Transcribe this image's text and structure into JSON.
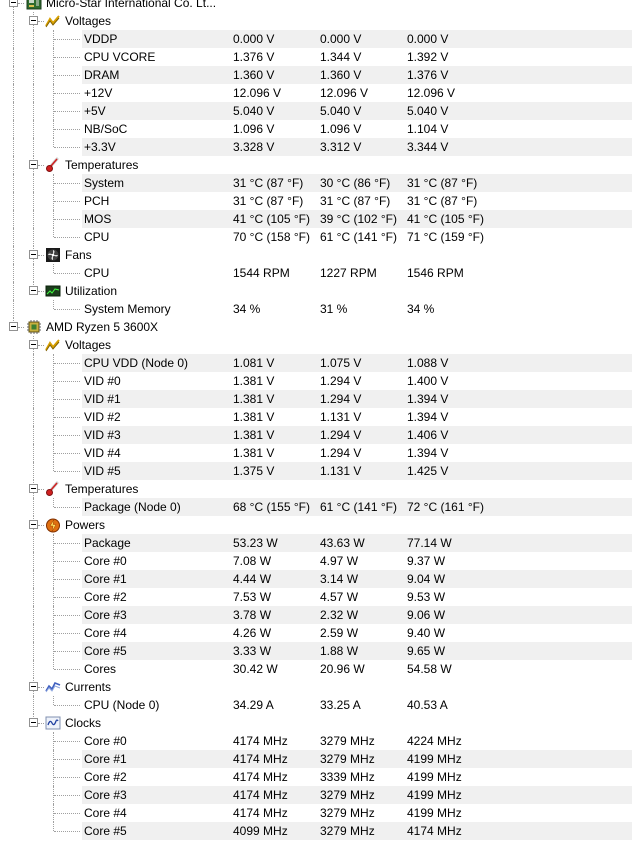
{
  "tree": [
    {
      "type": "device",
      "id": "msi",
      "name": "Micro-Star International Co. Lt...",
      "icon": "motherboard-icon",
      "groups": [
        {
          "id": "msi-voltages",
          "name": "Voltages",
          "icon": "voltage-icon",
          "rows": [
            {
              "label": "VDDP",
              "values": [
                "0.000 V",
                "0.000 V",
                "0.000 V"
              ]
            },
            {
              "label": "CPU VCORE",
              "values": [
                "1.376 V",
                "1.344 V",
                "1.392 V"
              ]
            },
            {
              "label": "DRAM",
              "values": [
                "1.360 V",
                "1.360 V",
                "1.376 V"
              ]
            },
            {
              "label": "+12V",
              "values": [
                "12.096 V",
                "12.096 V",
                "12.096 V"
              ]
            },
            {
              "label": "+5V",
              "values": [
                "5.040 V",
                "5.040 V",
                "5.040 V"
              ]
            },
            {
              "label": "NB/SoC",
              "values": [
                "1.096 V",
                "1.096 V",
                "1.104 V"
              ]
            },
            {
              "label": "+3.3V",
              "values": [
                "3.328 V",
                "3.312 V",
                "3.344 V"
              ]
            }
          ]
        },
        {
          "id": "msi-temperatures",
          "name": "Temperatures",
          "icon": "thermometer-icon",
          "rows": [
            {
              "label": "System",
              "values": [
                "31 °C  (87 °F)",
                "30 °C  (86 °F)",
                "31 °C  (87 °F)"
              ]
            },
            {
              "label": "PCH",
              "values": [
                "31 °C  (87 °F)",
                "31 °C  (87 °F)",
                "31 °C  (87 °F)"
              ]
            },
            {
              "label": "MOS",
              "values": [
                "41 °C  (105 °F)",
                "39 °C  (102 °F)",
                "41 °C  (105 °F)"
              ]
            },
            {
              "label": "CPU",
              "values": [
                "70 °C  (158 °F)",
                "61 °C  (141 °F)",
                "71 °C  (159 °F)"
              ]
            }
          ]
        },
        {
          "id": "msi-fans",
          "name": "Fans",
          "icon": "fan-icon",
          "rows": [
            {
              "label": "CPU",
              "values": [
                "1544 RPM",
                "1227 RPM",
                "1546 RPM"
              ]
            }
          ]
        },
        {
          "id": "msi-utilization",
          "name": "Utilization",
          "icon": "utilization-icon",
          "rows": [
            {
              "label": "System Memory",
              "values": [
                "34 %",
                "31 %",
                "34 %"
              ]
            }
          ]
        }
      ]
    },
    {
      "type": "device",
      "id": "cpu",
      "name": "AMD Ryzen 5 3600X",
      "icon": "cpu-chip-icon",
      "groups": [
        {
          "id": "cpu-voltages",
          "name": "Voltages",
          "icon": "voltage-icon",
          "rows": [
            {
              "label": "CPU VDD (Node 0)",
              "values": [
                "1.081 V",
                "1.075 V",
                "1.088 V"
              ]
            },
            {
              "label": "VID #0",
              "values": [
                "1.381 V",
                "1.294 V",
                "1.400 V"
              ]
            },
            {
              "label": "VID #1",
              "values": [
                "1.381 V",
                "1.294 V",
                "1.394 V"
              ]
            },
            {
              "label": "VID #2",
              "values": [
                "1.381 V",
                "1.131 V",
                "1.394 V"
              ]
            },
            {
              "label": "VID #3",
              "values": [
                "1.381 V",
                "1.294 V",
                "1.406 V"
              ]
            },
            {
              "label": "VID #4",
              "values": [
                "1.381 V",
                "1.294 V",
                "1.394 V"
              ]
            },
            {
              "label": "VID #5",
              "values": [
                "1.375 V",
                "1.131 V",
                "1.425 V"
              ]
            }
          ]
        },
        {
          "id": "cpu-temperatures",
          "name": "Temperatures",
          "icon": "thermometer-icon",
          "rows": [
            {
              "label": "Package (Node 0)",
              "values": [
                "68 °C  (155 °F)",
                "61 °C  (141 °F)",
                "72 °C  (161 °F)"
              ]
            }
          ]
        },
        {
          "id": "cpu-powers",
          "name": "Powers",
          "icon": "power-icon",
          "rows": [
            {
              "label": "Package",
              "values": [
                "53.23 W",
                "43.63 W",
                "77.14 W"
              ]
            },
            {
              "label": "Core #0",
              "values": [
                "7.08 W",
                "4.97 W",
                "9.37 W"
              ]
            },
            {
              "label": "Core #1",
              "values": [
                "4.44 W",
                "3.14 W",
                "9.04 W"
              ]
            },
            {
              "label": "Core #2",
              "values": [
                "7.53 W",
                "4.57 W",
                "9.53 W"
              ]
            },
            {
              "label": "Core #3",
              "values": [
                "3.78 W",
                "2.32 W",
                "9.06 W"
              ]
            },
            {
              "label": "Core #4",
              "values": [
                "4.26 W",
                "2.59 W",
                "9.40 W"
              ]
            },
            {
              "label": "Core #5",
              "values": [
                "3.33 W",
                "1.88 W",
                "9.65 W"
              ]
            },
            {
              "label": "Cores",
              "values": [
                "30.42 W",
                "20.96 W",
                "54.58 W"
              ]
            }
          ]
        },
        {
          "id": "cpu-currents",
          "name": "Currents",
          "icon": "current-icon",
          "rows": [
            {
              "label": "CPU (Node 0)",
              "values": [
                "34.29 A",
                "33.25 A",
                "40.53 A"
              ]
            }
          ]
        },
        {
          "id": "cpu-clocks",
          "name": "Clocks",
          "icon": "clock-wave-icon",
          "rows": [
            {
              "label": "Core #0",
              "values": [
                "4174 MHz",
                "3279 MHz",
                "4224 MHz"
              ]
            },
            {
              "label": "Core #1",
              "values": [
                "4174 MHz",
                "3279 MHz",
                "4199 MHz"
              ]
            },
            {
              "label": "Core #2",
              "values": [
                "4174 MHz",
                "3339 MHz",
                "4199 MHz"
              ]
            },
            {
              "label": "Core #3",
              "values": [
                "4174 MHz",
                "3279 MHz",
                "4199 MHz"
              ]
            },
            {
              "label": "Core #4",
              "values": [
                "4174 MHz",
                "3279 MHz",
                "4199 MHz"
              ]
            },
            {
              "label": "Core #5",
              "values": [
                "4099 MHz",
                "3279 MHz",
                "4174 MHz"
              ]
            }
          ]
        }
      ]
    }
  ]
}
